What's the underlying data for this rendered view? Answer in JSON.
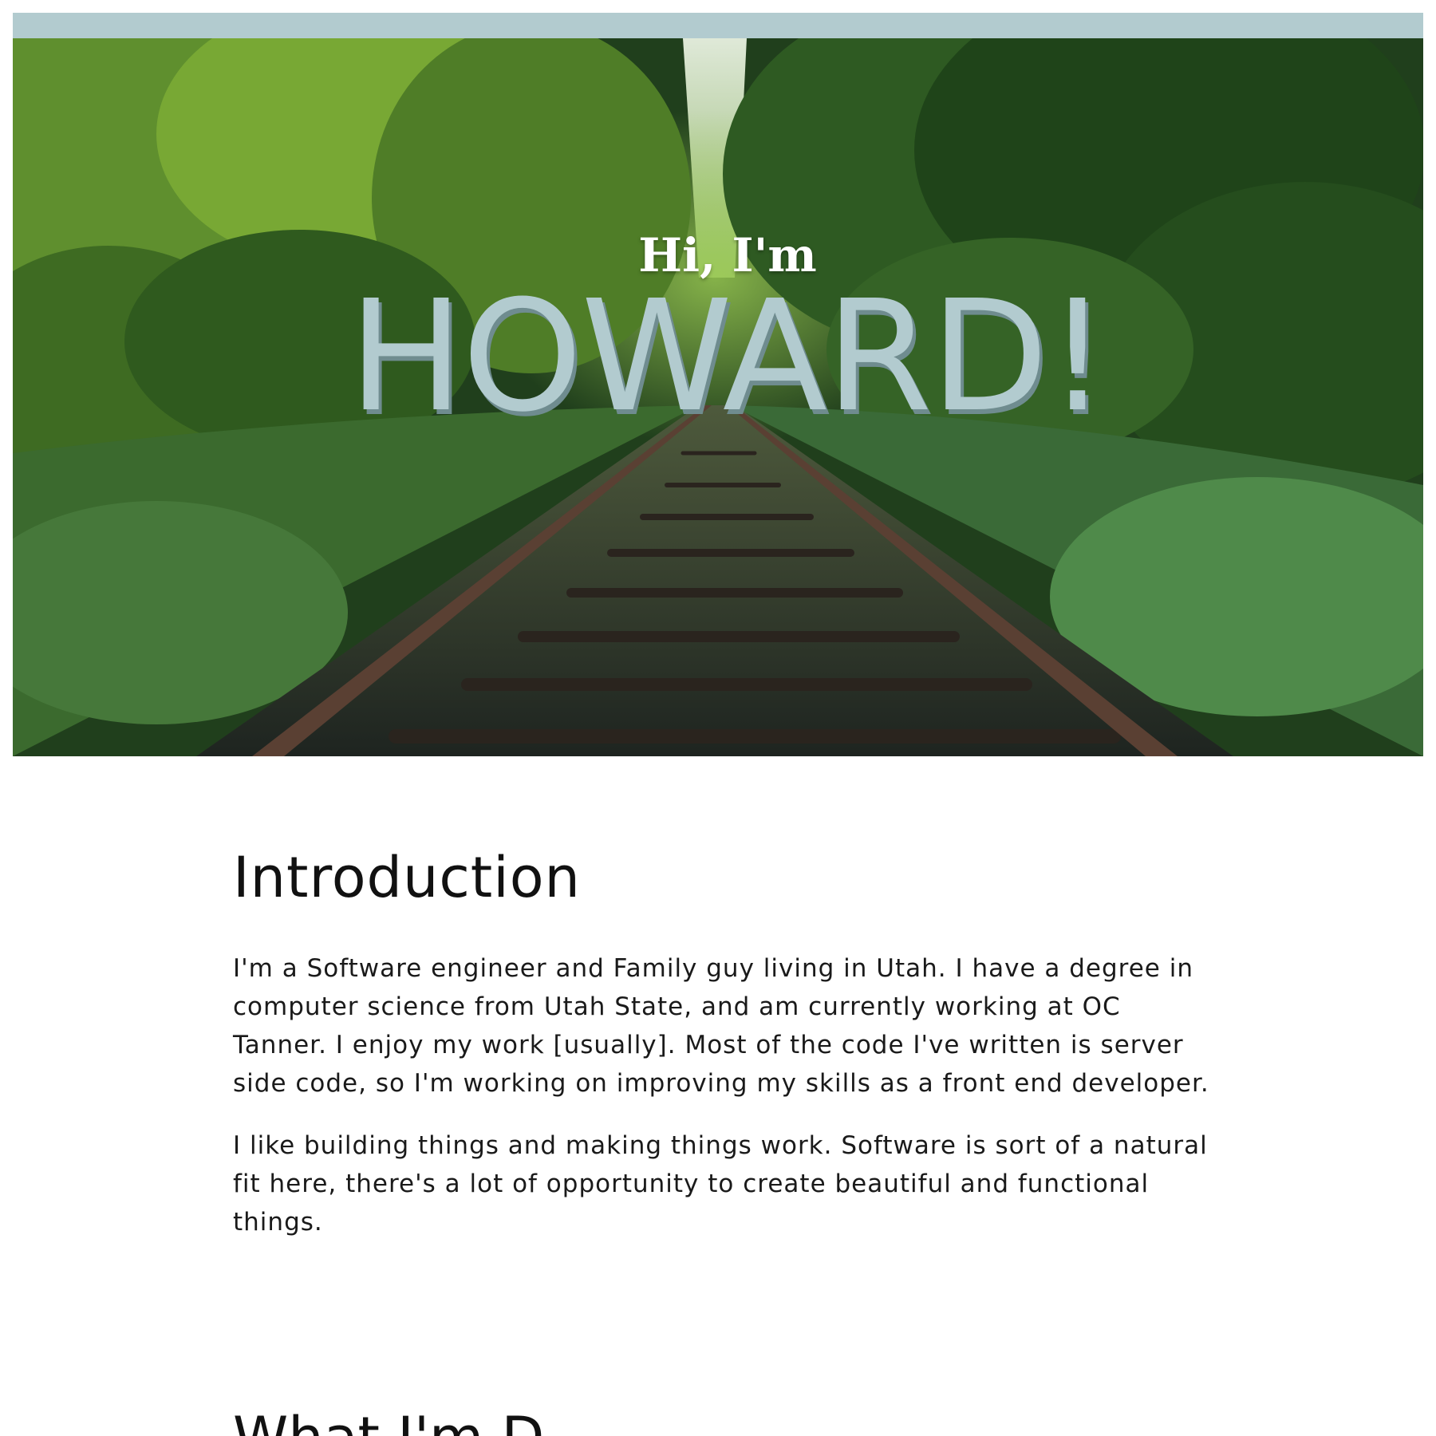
{
  "hero": {
    "greeting": "Hi, I'm",
    "name": "HOWARD!",
    "accent_color": "#b2cbcf"
  },
  "intro": {
    "title": "Introduction",
    "paragraphs": [
      "I'm a Software engineer and Family guy living in Utah. I have a degree in computer science from Utah State, and am currently working at OC Tanner. I enjoy my work [usually]. Most of the code I've written is server side code, so I'm working on improving my skills as a front end developer.",
      "I like building things and making things work. Software is sort of a natural fit here, there's a lot of opportunity to create beautiful and functional things."
    ]
  },
  "next_section": {
    "title_partial": "What I'm D"
  }
}
